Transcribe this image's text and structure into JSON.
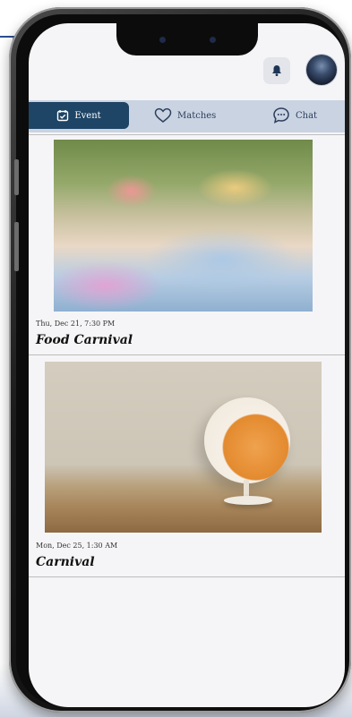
{
  "tabs": {
    "event_label": "Event",
    "matches_label": "Matches",
    "chat_label": "Chat"
  },
  "events": [
    {
      "date": "Thu, Dec 21, 7:30 PM",
      "title": "Food Carnival"
    },
    {
      "date": "Mon, Dec 25, 1:30 AM",
      "title": "Carnival"
    }
  ],
  "icons": {
    "notification": "bell-icon",
    "event": "calendar-check-icon",
    "matches": "heart-icon",
    "chat": "chat-bubble-icon"
  },
  "colors": {
    "active_tab": "#1e4466",
    "tab_bar": "#c9d3e2"
  }
}
